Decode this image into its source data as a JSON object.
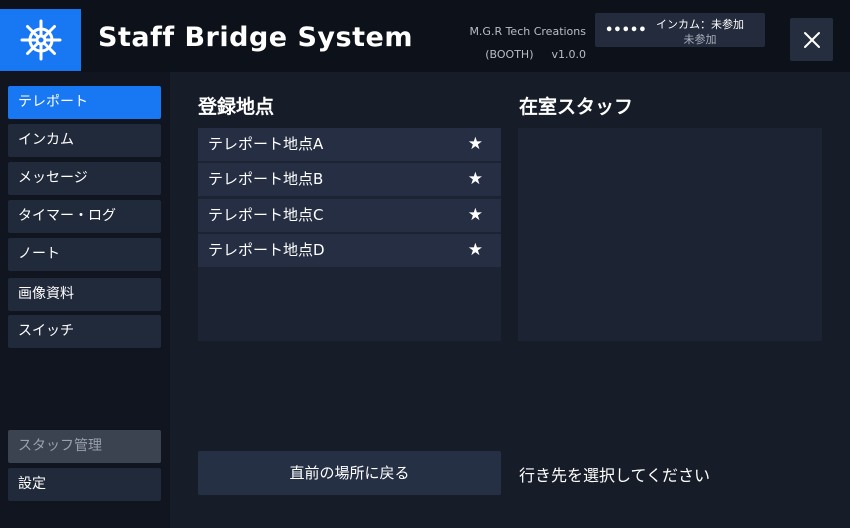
{
  "header": {
    "title": "Staff Bridge System",
    "logo_icon": "ship-wheel-icon",
    "credit_line1": "M.G.R Tech Creations",
    "credit_booth": "(BOOTH)",
    "credit_version": "v1.0.0",
    "intercom_dots": "•••••",
    "intercom_status_line1": "インカム：未参加",
    "intercom_status_line2": "未参加",
    "close_icon": "close-icon"
  },
  "sidebar": {
    "items": [
      {
        "label": "テレポート"
      },
      {
        "label": "インカム"
      },
      {
        "label": "メッセージ"
      },
      {
        "label": "タイマー・ログ"
      },
      {
        "label": "ノート"
      },
      {
        "label": "画像資料"
      },
      {
        "label": "スイッチ"
      }
    ],
    "staff_manage": "スタッフ管理",
    "settings": "設定"
  },
  "main": {
    "locations_title": "登録地点",
    "staff_title": "在室スタッフ",
    "locations": [
      {
        "name": "テレポート地点A",
        "fav": "★"
      },
      {
        "name": "テレポート地点B",
        "fav": "★"
      },
      {
        "name": "テレポート地点C",
        "fav": "★"
      },
      {
        "name": "テレポート地点D",
        "fav": "★"
      }
    ],
    "back_button": "直前の場所に戻る",
    "status_message": "行き先を選択してください"
  },
  "colors": {
    "accent": "#1877f2",
    "background": "#171c29",
    "panel": "#1c2333",
    "row": "#252e42"
  }
}
